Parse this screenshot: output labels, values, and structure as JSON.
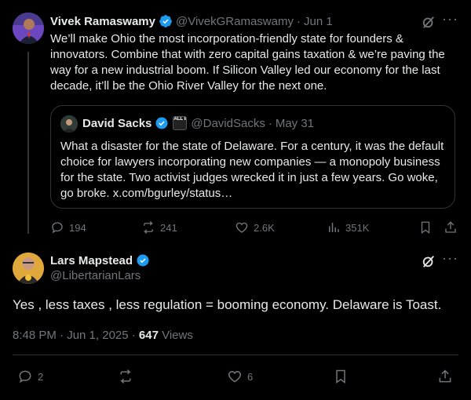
{
  "post1": {
    "author_name": "Vivek Ramaswamy",
    "handle": "@VivekGRamaswamy",
    "date": "Jun 1",
    "text": "We’ll make Ohio the most incorporation-friendly state for founders & innovators. Combine that with zero capital gains taxation & we’re paving the way for a new industrial boom. If Silicon Valley led our economy for the last decade, it’ll be the Ohio River Valley for the next one.",
    "quote": {
      "author_name": "David Sacks",
      "badge_text": "ALL IN",
      "handle": "@DavidSacks",
      "date": "May 31",
      "text": "What a disaster for the state of Delaware. For a century, it was the default choice for lawyers incorporating new companies — a monopoly business for the state. Two activist judges wrecked it in just a few years. Go woke, go broke. x.com/bgurley/status…"
    },
    "stats": {
      "replies": "194",
      "reposts": "241",
      "likes": "2.6K",
      "views": "351K"
    }
  },
  "post2": {
    "author_name": "Lars Mapstead",
    "handle": "@LibertarianLars",
    "text": "Yes , less taxes , less regulation = booming economy. Delaware is Toast.",
    "timestamp": "8:48 PM · Jun 1, 2025 · ",
    "views_count": "647",
    "views_label": " Views",
    "stats": {
      "replies": "2",
      "likes": "6"
    }
  },
  "colors": {
    "verified": "#1d9bf0",
    "muted": "#71767b",
    "border": "#2f3336",
    "bg": "#000000"
  }
}
